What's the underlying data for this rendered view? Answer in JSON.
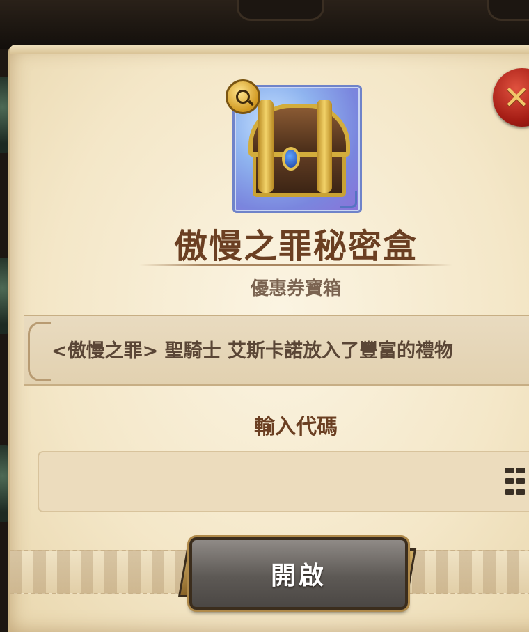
{
  "dialog": {
    "item_name": "傲慢之罪秘密盒",
    "item_type": "優惠券寶箱",
    "description": "<傲慢之罪> 聖騎士 艾斯卡諾放入了豐富的禮物",
    "code_label": "輸入代碼",
    "code_input": {
      "value": "",
      "placeholder": ""
    },
    "open_button_label": "開啟",
    "close_icon": "close-icon",
    "magnify_icon": "magnifier-icon",
    "keypad_icon": "keypad-icon"
  },
  "colors": {
    "title": "#6b3f22",
    "parchment": "#f4e7c8",
    "close_button": "#a51d15",
    "open_button": "#5d5955"
  }
}
